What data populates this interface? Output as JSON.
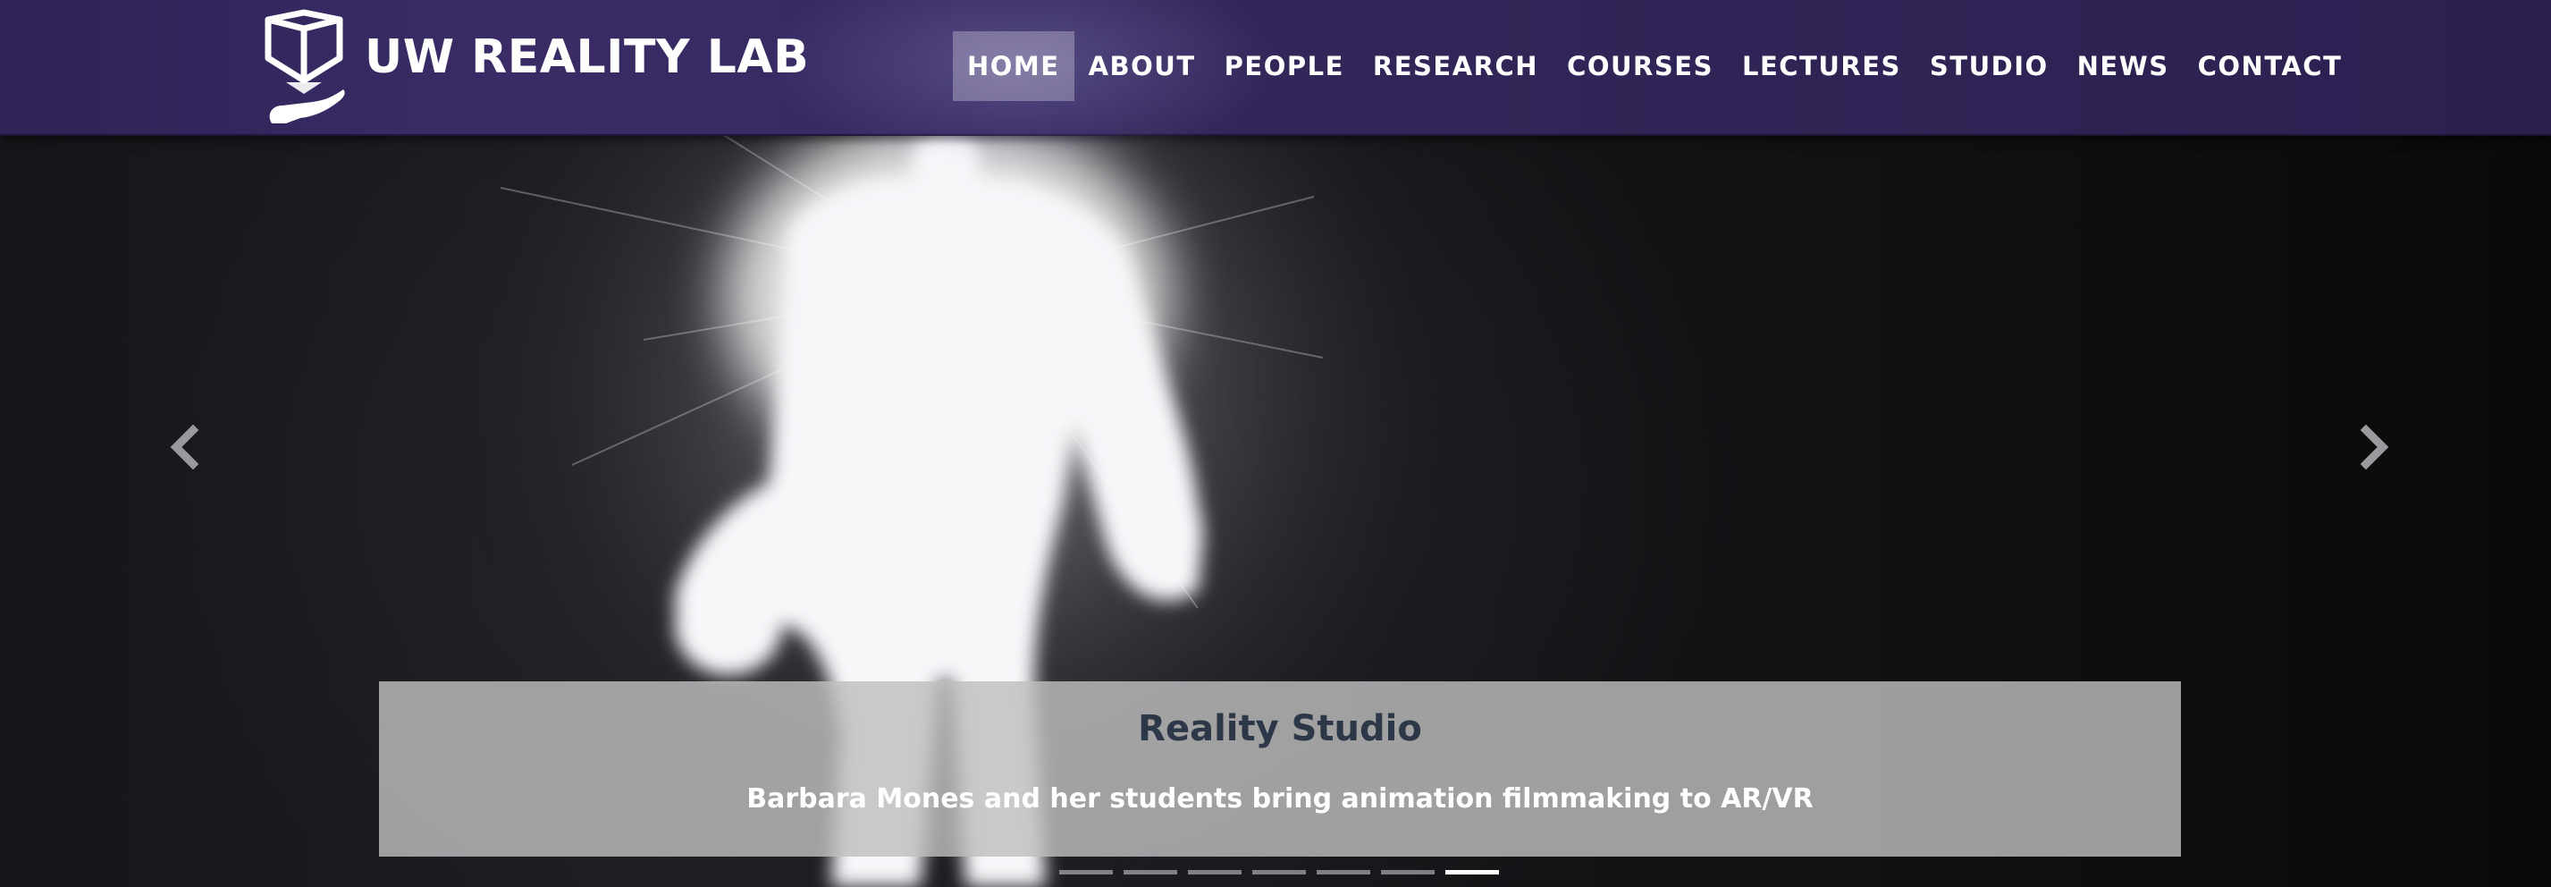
{
  "header": {
    "brand": "UW REALITY LAB",
    "logo_icon": "cube-in-hand-icon",
    "nav": [
      {
        "label": "HOME",
        "active": true
      },
      {
        "label": "ABOUT",
        "active": false
      },
      {
        "label": "PEOPLE",
        "active": false
      },
      {
        "label": "RESEARCH",
        "active": false
      },
      {
        "label": "COURSES",
        "active": false
      },
      {
        "label": "LECTURES",
        "active": false
      },
      {
        "label": "STUDIO",
        "active": false
      },
      {
        "label": "NEWS",
        "active": false
      },
      {
        "label": "CONTACT",
        "active": false
      }
    ]
  },
  "carousel": {
    "prev_icon": "chevron-left-icon",
    "next_icon": "chevron-right-icon",
    "caption": {
      "title": "Reality Studio",
      "subtitle": "Barbara Mones and her students bring animation filmmaking to AR/VR"
    },
    "slide_count": 7,
    "active_slide": 7
  },
  "colors": {
    "header_bg": "#2f2356",
    "caption_title": "#2c3747",
    "caption_bg": "#bebebe"
  }
}
